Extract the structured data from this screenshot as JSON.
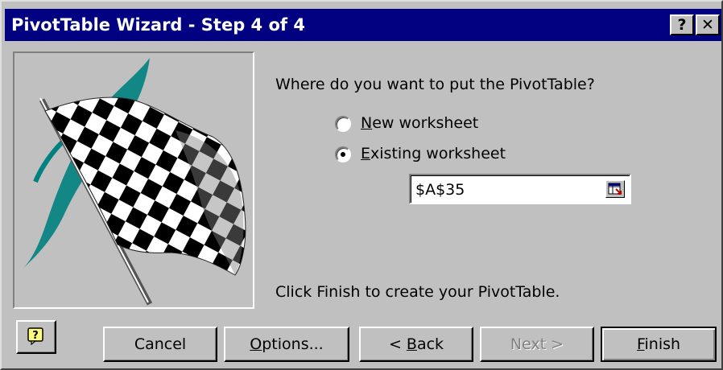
{
  "window": {
    "title": "PivotTable Wizard - Step 4 of 4",
    "help_glyph": "?",
    "close_glyph": "✕"
  },
  "main": {
    "question": "Where do you want to put the PivotTable?",
    "options": [
      {
        "label_ul": "N",
        "label_rest": "ew worksheet",
        "selected": false
      },
      {
        "label_ul": "E",
        "label_rest": "xisting worksheet",
        "selected": true
      }
    ],
    "reference": "$A$35",
    "hint": "Click Finish to create your PivotTable."
  },
  "buttons": {
    "cancel": "Cancel",
    "options_ul": "O",
    "options_rest": "ptions...",
    "back_pre": "< ",
    "back_ul": "B",
    "back_rest": "ack",
    "next": "Next >",
    "finish_ul": "F",
    "finish_rest": "inish"
  },
  "colors": {
    "titlebar": "#000080",
    "face": "#c0c0c0",
    "flag_swoosh": "#008080"
  },
  "icons": {
    "picture": "checkered-flag",
    "assistant": "office-assistant-help-icon",
    "collapse": "collapse-dialog-icon"
  }
}
